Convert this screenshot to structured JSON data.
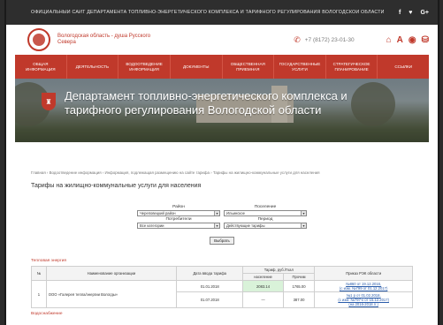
{
  "topbar": {
    "site_label": "Официальный сайт Департамента топливно-энергетического комплекса и тарифного регулирования Вологодской области",
    "social": [
      "f",
      "♥",
      "G+"
    ]
  },
  "header": {
    "logo_text": "Вологодская область - душа Русского Севера",
    "phone": "+7 (8172) 23-01-30"
  },
  "nav": {
    "items": [
      "Общая информация",
      "Деятельность",
      "Водоотведение информация",
      "Документы",
      "Общественная приемная",
      "Государственные услуги",
      "Стратегическое планирование",
      "Ссылки"
    ]
  },
  "banner": {
    "title": "Департамент топливно-энергетического комплекса и тарифного регулирования Вологодской области"
  },
  "breadcrumb": "Главная › Водоотведение информация › Информация, подлежащая размещению на сайте тарифа › Тарифы на жилищно-коммунальные услуги для населения",
  "page_title": "Тарифы на жилищно-коммунальные услуги для населения",
  "filters": {
    "district_label": "Район",
    "settlement_label": "Поселение",
    "consumer_label": "Потребители",
    "period_label": "Период",
    "district_value": "Череповецкий район",
    "settlement_value": "Ильинское",
    "consumer_value": "Все категории",
    "period_value": "Действующие тарифы",
    "submit_label": "Выбрать"
  },
  "section_heat": "Тепловая энергия",
  "table": {
    "headers": {
      "num": "№",
      "org": "Наименование организации",
      "date": "Дата ввода тарифа",
      "tariff": "Тариф, руб./Гкал",
      "pop": "население",
      "other": "Прочим",
      "order": "Приказ РЭК области"
    },
    "row": {
      "num": "1",
      "org": "ООО «Галерея тепла/энергии Вологды»",
      "date1": "01.01.2018",
      "pop1": "2083.14",
      "other1": "1765.00",
      "date2": "01.07.2018",
      "pop2": "—",
      "other2": "387.00",
      "links1": [
        "№860 от 19.12.2016,",
        "(с изм. №799 от 01.12.2017)"
      ],
      "links2": [
        "№1 р от 01.02.2018,",
        "(с изм. №797-к от 15.12.2017)",
        "(на 2016-2018 гг.)"
      ]
    }
  },
  "section_water": "Водоснабжение",
  "colors": {
    "accent": "#c0392b",
    "topbar": "#2e2e2e",
    "link": "#2a5caa"
  }
}
